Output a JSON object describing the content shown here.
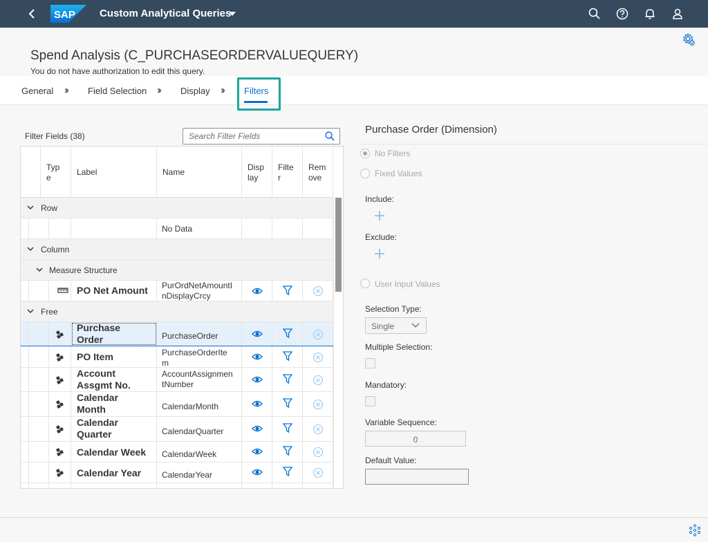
{
  "shell": {
    "logo_text": "SAP",
    "app_title": "Custom Analytical Queries"
  },
  "page": {
    "title": "Spend Analysis (C_PURCHASEORDERVALUEQUERY)",
    "subtitle": "You do not have authorization to edit this query."
  },
  "tabs": [
    {
      "label": "General",
      "active": false
    },
    {
      "label": "Field Selection",
      "active": false
    },
    {
      "label": "Display",
      "active": false
    },
    {
      "label": "Filters",
      "active": true
    }
  ],
  "filter_fields": {
    "label": "Filter Fields (38)",
    "search_placeholder": "Search Filter Fields",
    "columns": {
      "type": [
        "Typ",
        "e"
      ],
      "label": "Label",
      "name": "Name",
      "display": [
        "Disp",
        "lay"
      ],
      "filter": [
        "Filte",
        "r"
      ],
      "remove": [
        "Rem",
        "ove"
      ]
    },
    "groups": {
      "row": "Row",
      "column": "Column",
      "measure_structure": "Measure Structure",
      "free": "Free"
    },
    "no_data": "No Data",
    "measure": {
      "label": "PO Net Amount",
      "name_l1": "PurOrdNetAmountI",
      "name_l2": "nDisplayCrcy",
      "icon": "measure-ruler-icon"
    },
    "rows": [
      {
        "label_l1": "Purchase",
        "label_l2": "Order",
        "name_l1": "PurchaseOrder",
        "name_l2": "",
        "selected": true,
        "icon": "dimension-icon"
      },
      {
        "label_l1": "PO Item",
        "label_l2": "",
        "name_l1": "PurchaseOrderIte",
        "name_l2": "m",
        "selected": false,
        "icon": "dimension-icon"
      },
      {
        "label_l1": "Account",
        "label_l2": "Assgmt No.",
        "name_l1": "AccountAssignmen",
        "name_l2": "tNumber",
        "selected": false,
        "icon": "dimension-icon"
      },
      {
        "label_l1": "Calendar",
        "label_l2": "Month",
        "name_l1": "CalendarMonth",
        "name_l2": "",
        "selected": false,
        "icon": "dimension-icon"
      },
      {
        "label_l1": "Calendar",
        "label_l2": "Quarter",
        "name_l1": "CalendarQuarter",
        "name_l2": "",
        "selected": false,
        "icon": "dimension-icon"
      },
      {
        "label_l1": "Calendar Week",
        "label_l2": "",
        "name_l1": "CalendarWeek",
        "name_l2": "",
        "selected": false,
        "icon": "dimension-icon"
      },
      {
        "label_l1": "Calendar Year",
        "label_l2": "",
        "name_l1": "CalendarYear",
        "name_l2": "",
        "selected": false,
        "icon": "dimension-icon"
      }
    ]
  },
  "details": {
    "title": "Purchase Order (Dimension)",
    "radio_no_filters": "No Filters",
    "radio_fixed_values": "Fixed Values",
    "include_label": "Include:",
    "exclude_label": "Exclude:",
    "radio_user_input": "User Input Values",
    "selection_type_label": "Selection Type:",
    "selection_type_value": "Single",
    "multiple_selection_label": "Multiple Selection:",
    "mandatory_label": "Mandatory:",
    "variable_sequence_label": "Variable Sequence:",
    "variable_sequence_value": "0",
    "default_value_label": "Default Value:",
    "default_value": ""
  },
  "colors": {
    "shell": "#354a5f",
    "accent": "#0a6ed1",
    "highlight": "#19a79a",
    "selected_row": "#e5f0fa"
  }
}
